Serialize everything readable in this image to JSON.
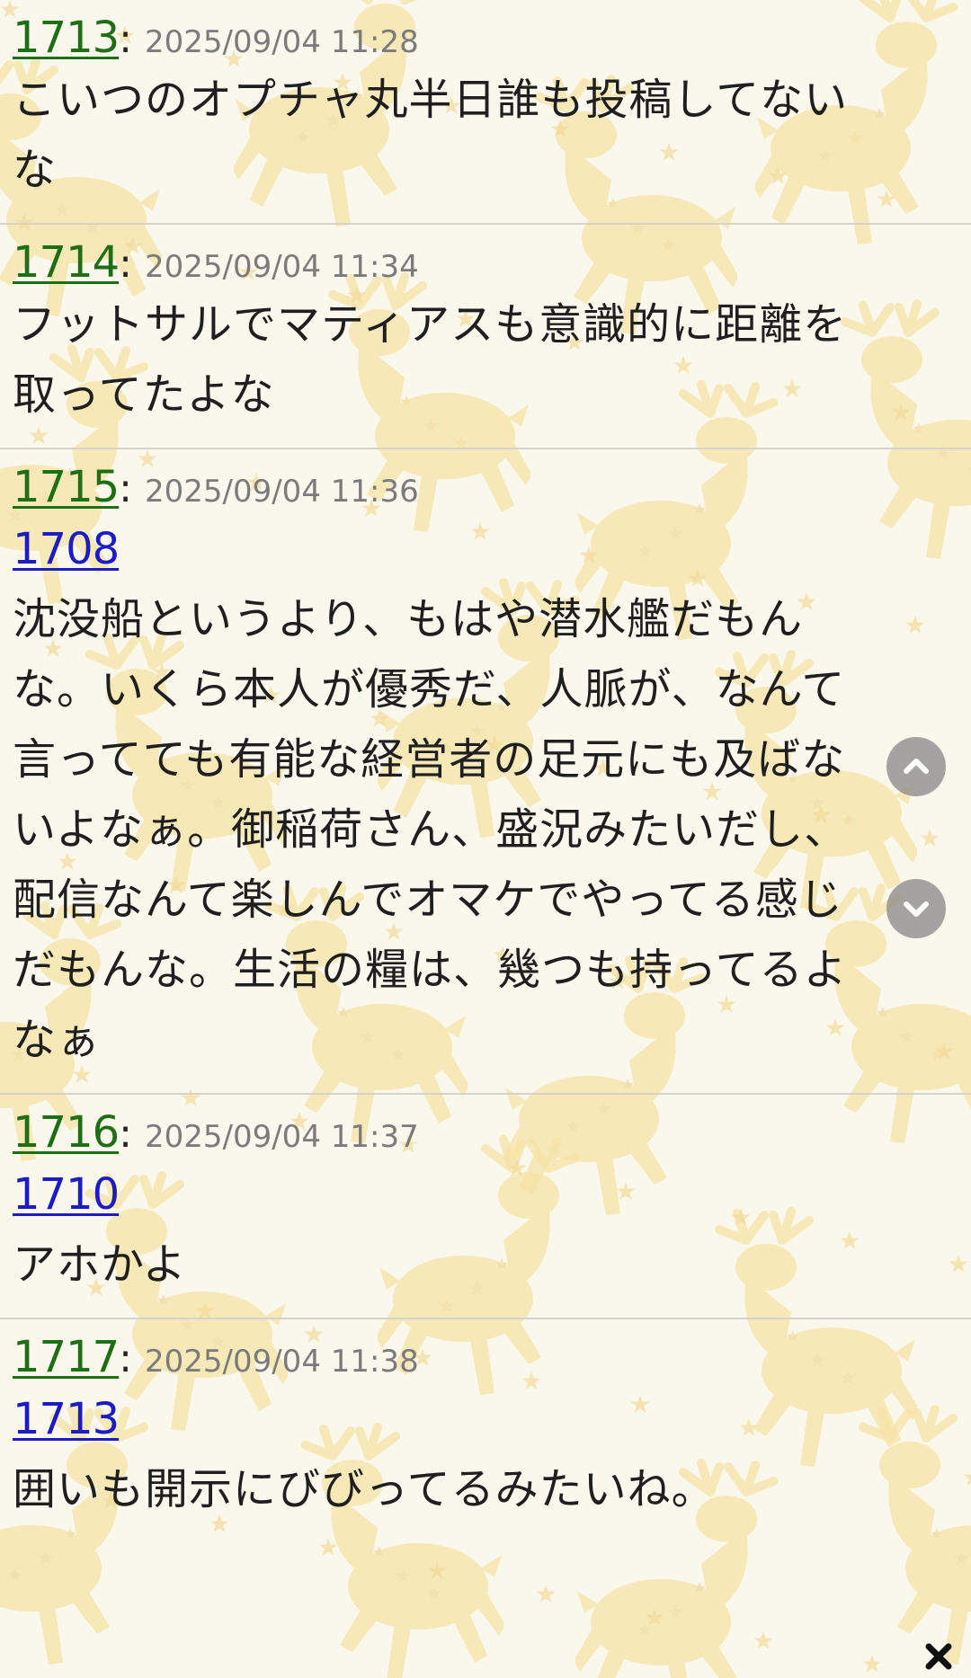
{
  "posts": [
    {
      "number": "1713",
      "colon": ":",
      "timestamp": "2025/09/04 11:28",
      "reply_to": null,
      "body": "こいつのオプチャ丸半日誰も投稿してない\nな"
    },
    {
      "number": "1714",
      "colon": ":",
      "timestamp": "2025/09/04 11:34",
      "reply_to": null,
      "body": "フットサルでマティアスも意識的に距離を\n取ってたよな"
    },
    {
      "number": "1715",
      "colon": ":",
      "timestamp": "2025/09/04 11:36",
      "reply_to": "1708",
      "body": "沈没船というより、もはや潜水艦だもん\nな。いくら本人が優秀だ、人脈が、なんて\n言ってても有能な経営者の足元にも及ばな\nいよなぁ。御稲荷さん、盛況みたいだし、\n配信なんて楽しんでオマケでやってる感じ\nだもんな。生活の糧は、幾つも持ってるよ\nなぁ"
    },
    {
      "number": "1716",
      "colon": ":",
      "timestamp": "2025/09/04 11:37",
      "reply_to": "1710",
      "body": "アホかよ"
    },
    {
      "number": "1717",
      "colon": ":",
      "timestamp": "2025/09/04 11:38",
      "reply_to": "1713",
      "body": "囲いも開示にびびってるみたいね。"
    }
  ],
  "controls": {
    "scroll_up_icon": "chevron-up-icon",
    "scroll_down_icon": "chevron-down-icon",
    "close_icon": "close-icon"
  },
  "colors": {
    "background": "#faf7ec",
    "pattern": "#f6e3a6",
    "post_number": "#1e6e14",
    "reply_link": "#1c1cc4",
    "timestamp": "#7b7b7b",
    "divider": "#d6d3cb"
  }
}
